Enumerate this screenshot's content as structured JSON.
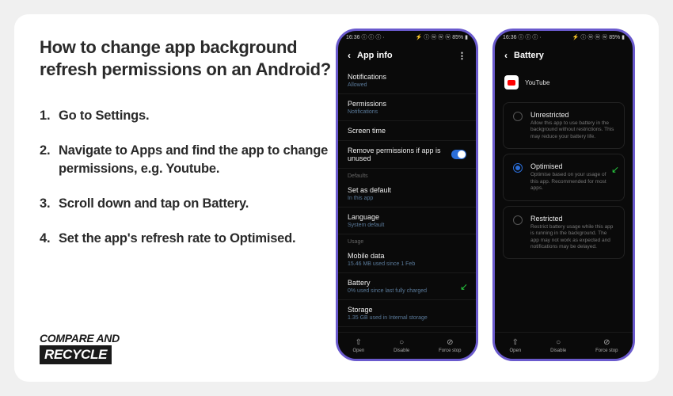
{
  "heading": "How to change app background refresh permissions on an Android?",
  "steps": [
    "Go to Settings.",
    "Navigate to Apps and find the app to change permissions, e.g. Youtube.",
    "Scroll down and tap on Battery.",
    "Set the app's refresh rate to Optimised."
  ],
  "logo": {
    "line1": "COMPARE AND",
    "line2": "RECYCLE"
  },
  "phone1": {
    "status_left": "16:36 ⓘ ⓘ ⓘ ·",
    "status_right": "⚡ ⓘ ⓦ ⓦ ⓦ 85% ▮",
    "title": "App info",
    "rows": {
      "notifications": {
        "label": "Notifications",
        "sub": "Allowed"
      },
      "permissions": {
        "label": "Permissions",
        "sub": "Notifications"
      },
      "screentime": {
        "label": "Screen time"
      },
      "removeperms": {
        "label": "Remove permissions if app is unused"
      },
      "section_defaults": "Defaults",
      "setdefault": {
        "label": "Set as default",
        "sub": "In this app"
      },
      "language": {
        "label": "Language",
        "sub": "System default"
      },
      "section_usage": "Usage",
      "mobiledata": {
        "label": "Mobile data",
        "sub": "15.46 MB used since 1 Feb"
      },
      "battery": {
        "label": "Battery",
        "sub": "0% used since last fully charged"
      },
      "storage": {
        "label": "Storage",
        "sub": "1.35 GB used in Internal storage"
      }
    },
    "bottombar": {
      "open": "Open",
      "disable": "Disable",
      "forcestop": "Force stop"
    }
  },
  "phone2": {
    "status_left": "16:36 ⓘ ⓘ ⓘ ·",
    "status_right": "⚡ ⓘ ⓦ ⓦ ⓦ 85% ▮",
    "title": "Battery",
    "app_name": "YouTube",
    "options": {
      "unrestricted": {
        "title": "Unrestricted",
        "desc": "Allow this app to use battery in the background without restrictions. This may reduce your battery life."
      },
      "optimised": {
        "title": "Optimised",
        "desc": "Optimise based on your usage of this app. Recommended for most apps."
      },
      "restricted": {
        "title": "Restricted",
        "desc": "Restrict battery usage while this app is running in the background. The app may not work as expected and notifications may be delayed."
      }
    },
    "bottombar": {
      "open": "Open",
      "disable": "Disable",
      "forcestop": "Force stop"
    }
  }
}
